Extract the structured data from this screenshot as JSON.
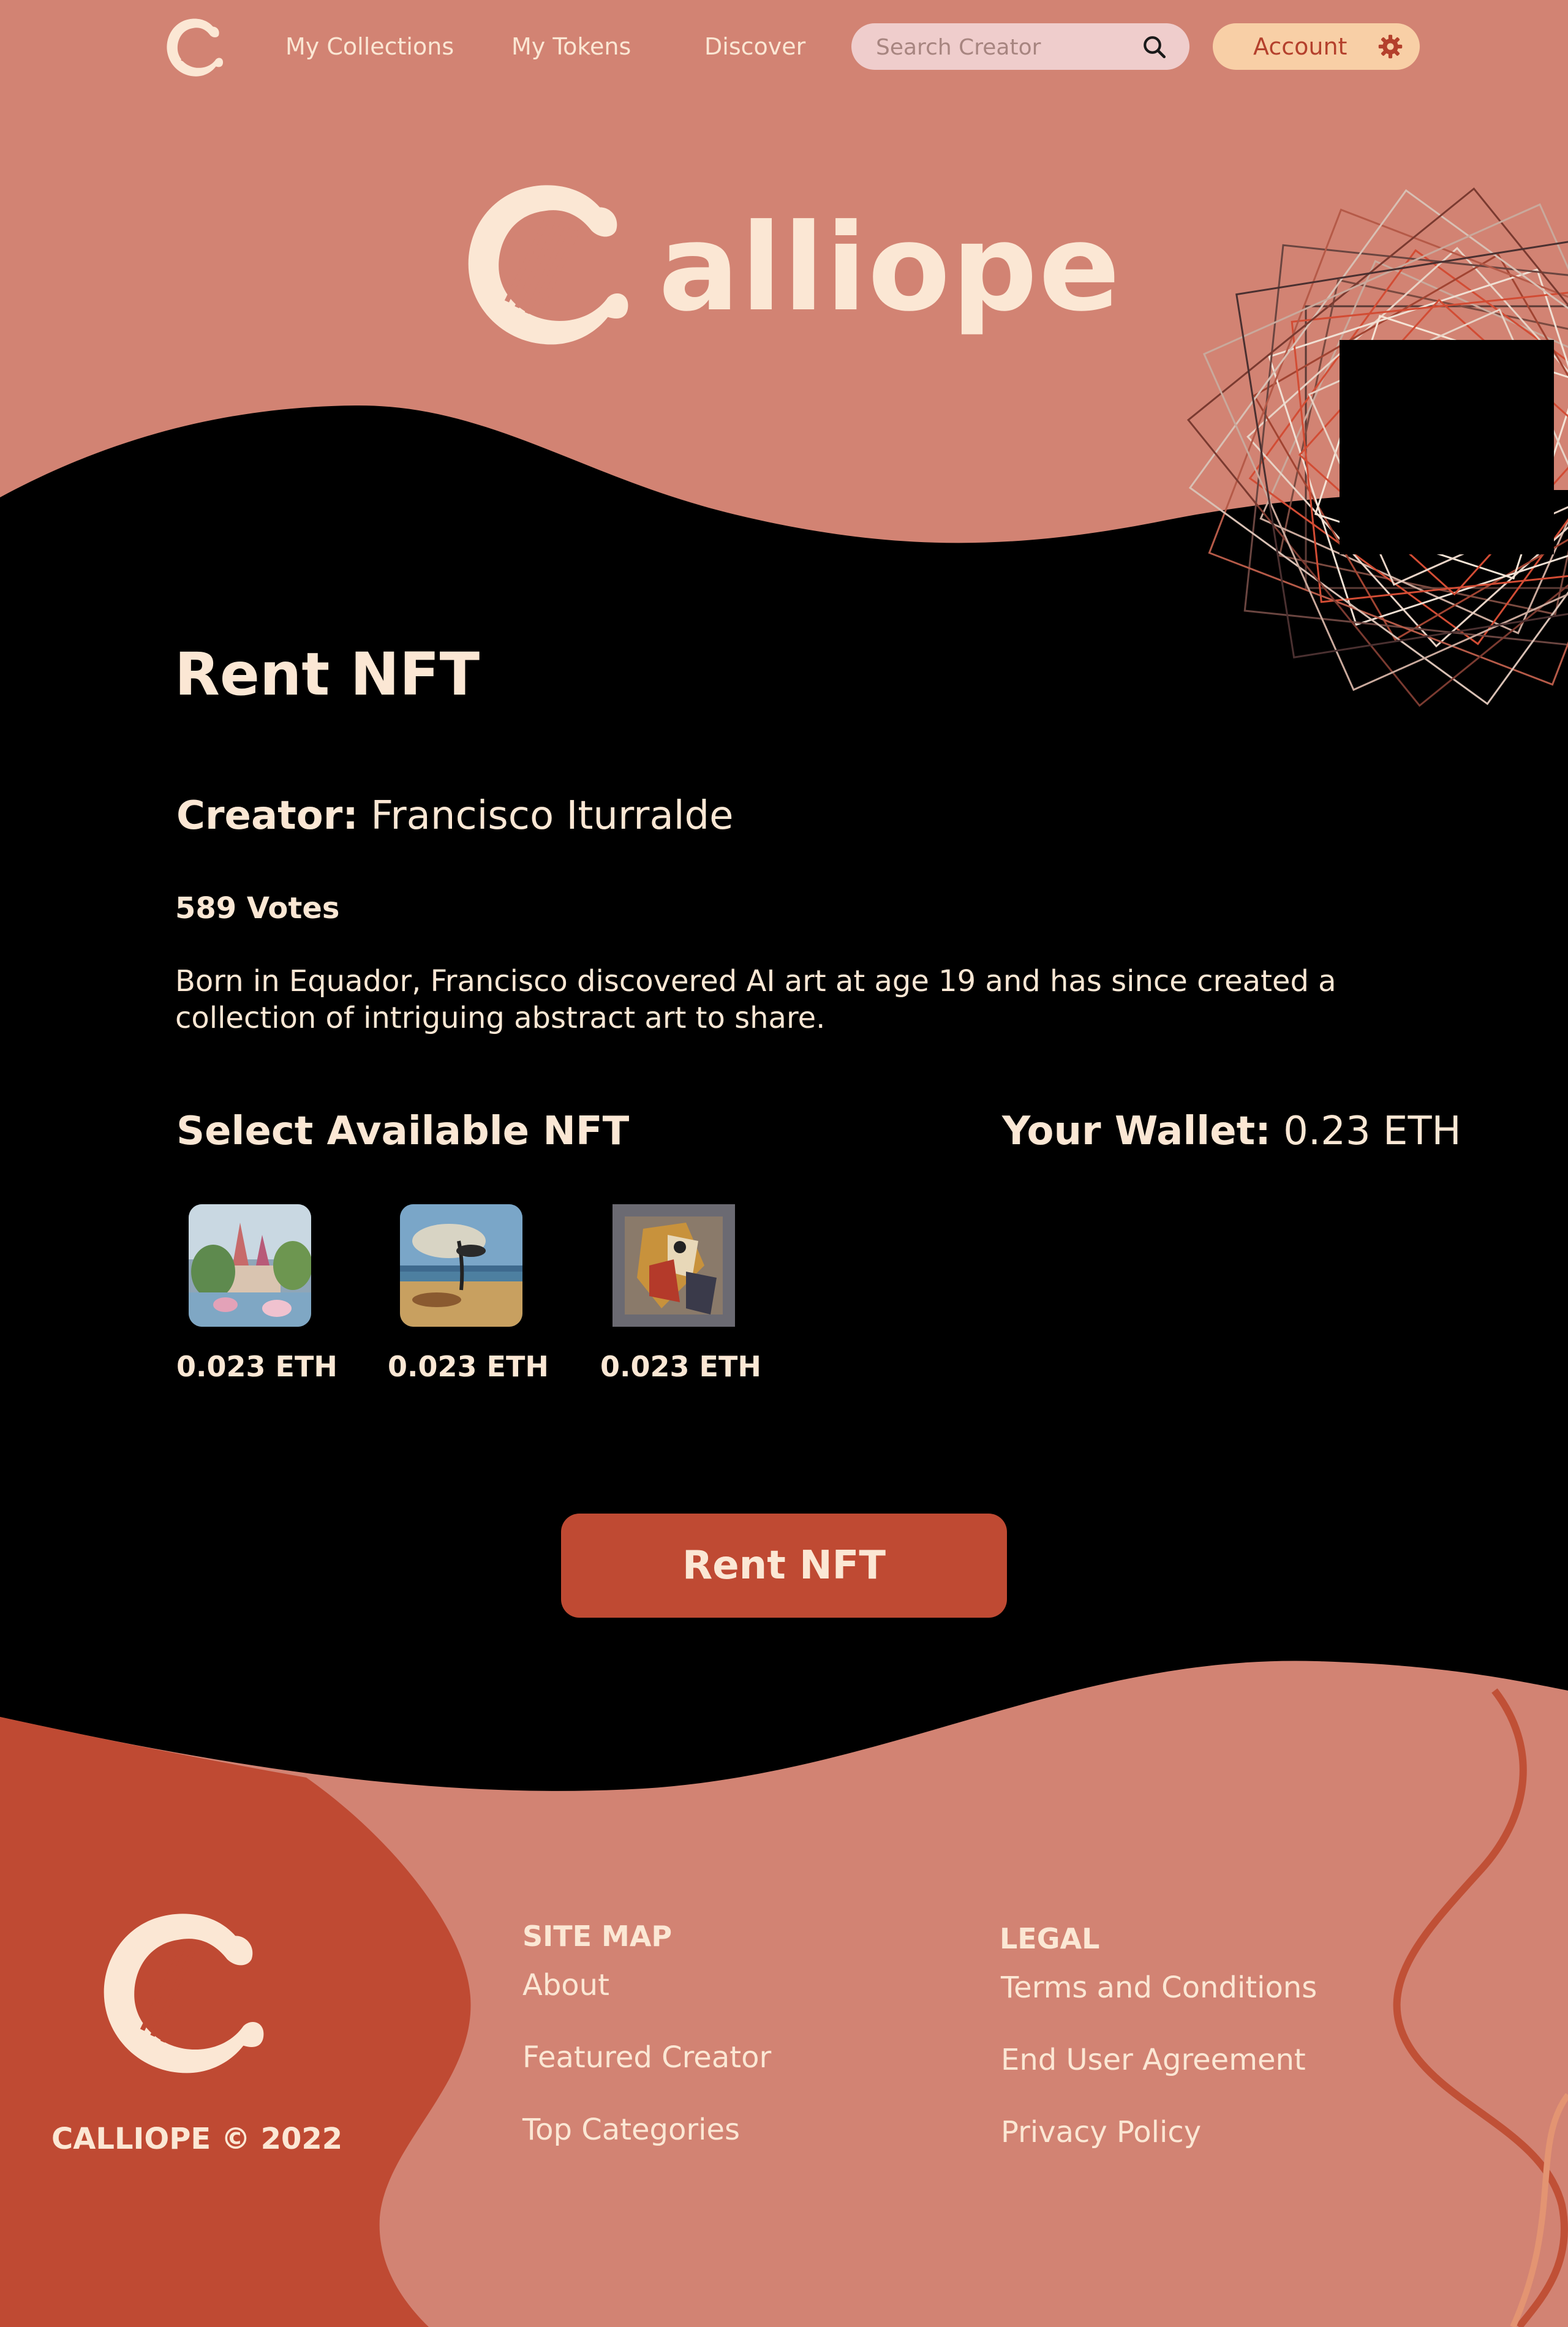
{
  "nav": {
    "links": [
      {
        "label": "My Collections"
      },
      {
        "label": "My Tokens"
      },
      {
        "label": "Discover"
      }
    ],
    "search": {
      "placeholder": "Search Creator",
      "value": ""
    },
    "account": {
      "label": "Account"
    }
  },
  "hero": {
    "brand": "alliope"
  },
  "main": {
    "title": "Rent NFT",
    "creator_label": "Creator:",
    "creator_name": "Francisco Iturralde",
    "votes": "589 Votes",
    "bio": "Born in Equador, Francisco discovered AI art at age 19 and has since created a collection of intriguing abstract art to share.",
    "select_title": "Select Available NFT",
    "wallet_label": "Your Wallet:",
    "wallet_value": "0.23 ETH",
    "nfts": [
      {
        "price": "0.023 ETH"
      },
      {
        "price": "0.023 ETH"
      },
      {
        "price": "0.023 ETH"
      }
    ],
    "rent_button": "Rent NFT"
  },
  "footer": {
    "copyright": "CALLIOPE © 2022",
    "sitemap": {
      "heading": "SITE MAP",
      "links": [
        {
          "label": "About"
        },
        {
          "label": "Featured Creator"
        },
        {
          "label": "Top Categories"
        }
      ]
    },
    "legal": {
      "heading": "LEGAL",
      "links": [
        {
          "label": "Terms and Conditions"
        },
        {
          "label": "End User Agreement"
        },
        {
          "label": "Privacy Policy"
        }
      ]
    }
  },
  "colors": {
    "salmon": "#d28373",
    "black": "#000000",
    "cream": "#fbe7d4",
    "brick": "#bf4a33",
    "peach": "#f8cfa6",
    "search_bg": "#efcdcc"
  },
  "icons": {
    "brand_logo": "harp-c-logo",
    "search": "magnifier-icon",
    "account": "gear-icon",
    "decoration": "geometric-star-decoration"
  }
}
